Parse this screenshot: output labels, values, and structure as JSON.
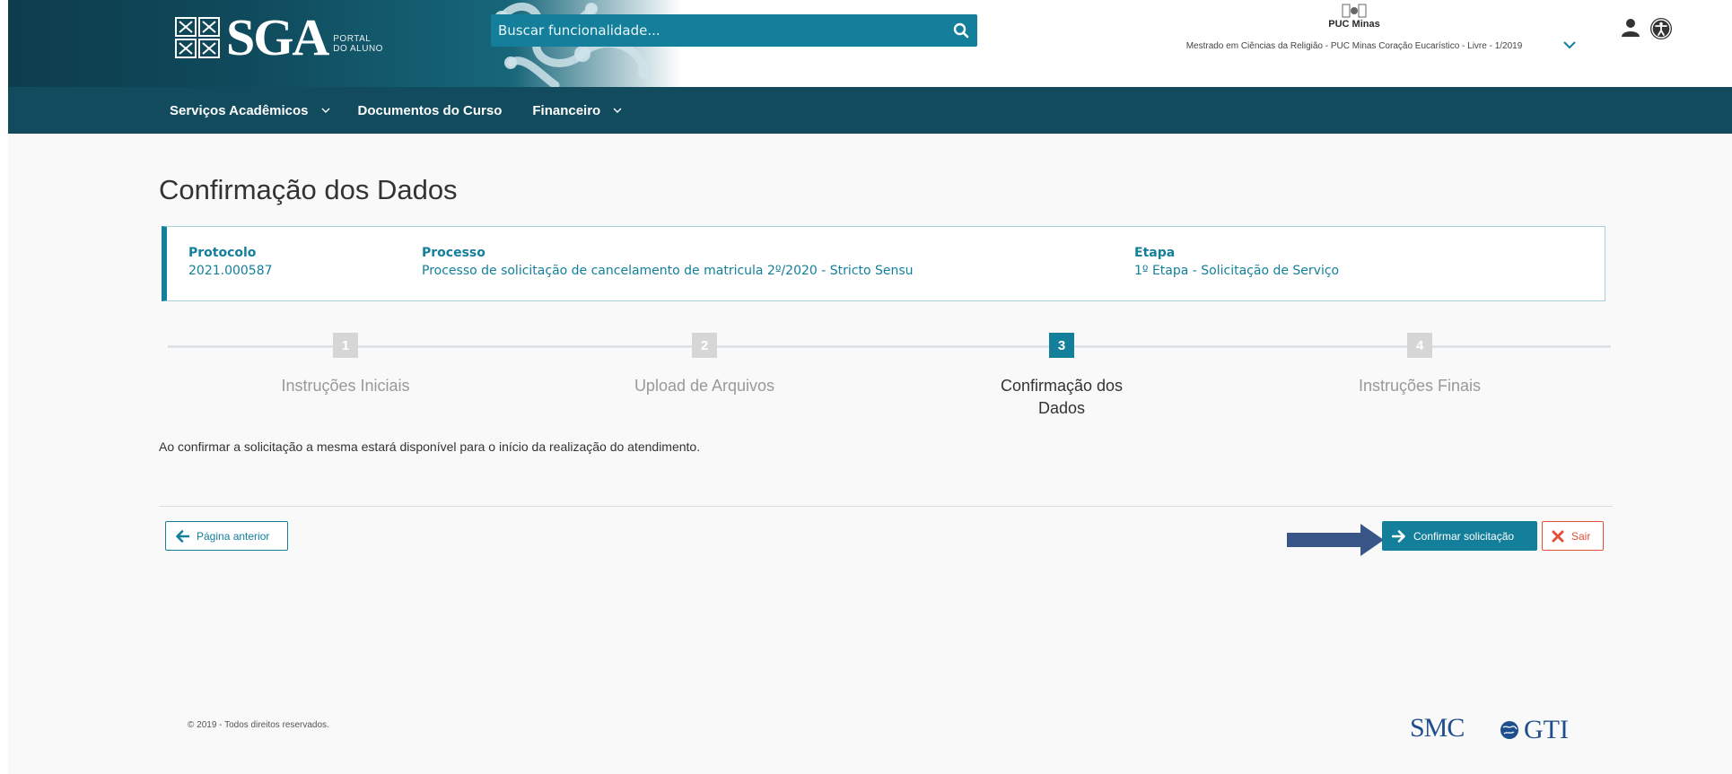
{
  "header": {
    "logo": "SGA",
    "logo_sub": [
      "PORTAL",
      "DO ALUNO"
    ],
    "search_placeholder": "Buscar funcionalidade...",
    "institution": "PUC Minas",
    "course": "Mestrado em Ciências da Religião - PUC Minas Coração Eucarístico - Livre - 1/2019"
  },
  "nav": {
    "items": [
      {
        "label": "Serviços Acadêmicos",
        "dropdown": true
      },
      {
        "label": "Documentos do Curso",
        "dropdown": false
      },
      {
        "label": "Financeiro",
        "dropdown": true
      }
    ]
  },
  "page": {
    "title": "Confirmação dos Dados",
    "info": {
      "protocolo_label": "Protocolo",
      "protocolo_value": "2021.000587",
      "processo_label": "Processo",
      "processo_value": "Processo de solicitação de cancelamento de matricula 2º/2020 - Stricto Sensu",
      "etapa_label": "Etapa",
      "etapa_value": "1º Etapa - Solicitação de Serviço"
    },
    "steps": [
      {
        "num": "1",
        "label": "Instruções Iniciais",
        "active": false
      },
      {
        "num": "2",
        "label": "Upload de Arquivos",
        "active": false
      },
      {
        "num": "3",
        "label": "Confirmação dos Dados",
        "active": true
      },
      {
        "num": "4",
        "label": "Instruções Finais",
        "active": false
      }
    ],
    "note": "Ao confirmar a solicitação a mesma estará disponível para o início da realização do atendimento.",
    "buttons": {
      "prev": "Página anterior",
      "confirm": "Confirmar solicitação",
      "exit": "Sair"
    }
  },
  "footer": {
    "copyright": "© 2019 - Todos direitos reservados.",
    "logo_smc": "SMC",
    "logo_gti": "GTI"
  },
  "colors": {
    "primary": "#137f9a",
    "nav_bg": "#124b5d",
    "danger": "#e0503b"
  }
}
